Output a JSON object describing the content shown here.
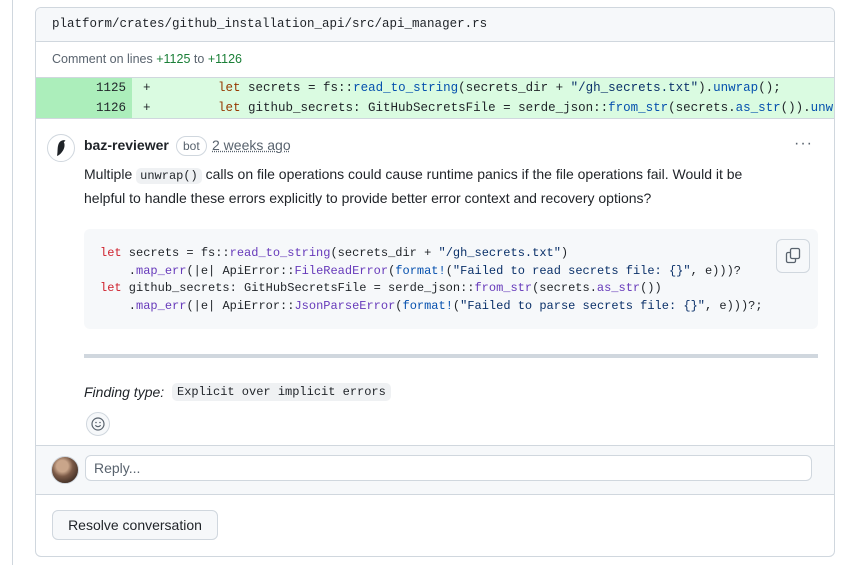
{
  "file": {
    "path": "platform/crates/github_installation_api/src/api_manager.rs"
  },
  "lines_note": {
    "prefix": "Comment on lines",
    "from": "+1125",
    "to_word": "to",
    "to": "+1126"
  },
  "diff": [
    {
      "num": "1125",
      "sign": "+",
      "code": "    let secrets = fs::read_to_string(secrets_dir + \"/gh_secrets.txt\").unwrap();"
    },
    {
      "num": "1126",
      "sign": "+",
      "code": "    let github_secrets: GitHubSecretsFile = serde_json::from_str(secrets.as_str()).unwrap();"
    }
  ],
  "comment": {
    "author": "baz-reviewer",
    "badge": "bot",
    "time": "2 weeks ago",
    "more": "···",
    "body_before": "Multiple ",
    "body_code": "unwrap()",
    "body_after": " calls on file operations could cause runtime panics if the file operations fail. Would it be helpful to handle these errors explicitly to provide better error context and recovery options?",
    "suggestion": [
      "let secrets = fs::read_to_string(secrets_dir + \"/gh_secrets.txt\")",
      "    .map_err(|e| ApiError::FileReadError(format!(\"Failed to read secrets file: {}\", e)))?",
      "let github_secrets: GitHubSecretsFile = serde_json::from_str(secrets.as_str())",
      "    .map_err(|e| ApiError::JsonParseError(format!(\"Failed to parse secrets file: {}\", e)))?;"
    ],
    "finding_label": "Finding type:",
    "finding_value": "Explicit over implicit errors"
  },
  "reply": {
    "placeholder": "Reply..."
  },
  "actions": {
    "resolve_label": "Resolve conversation"
  },
  "icons": {
    "bird": "bird-icon",
    "copy": "copy-icon",
    "emoji": "smiley-icon",
    "more": "kebab-horizontal-icon"
  },
  "colors": {
    "added_bg": "#dafbe1",
    "added_num_bg": "#aceebb",
    "border": "#d0d7de",
    "muted": "#59636e",
    "green": "#1a7f37"
  }
}
